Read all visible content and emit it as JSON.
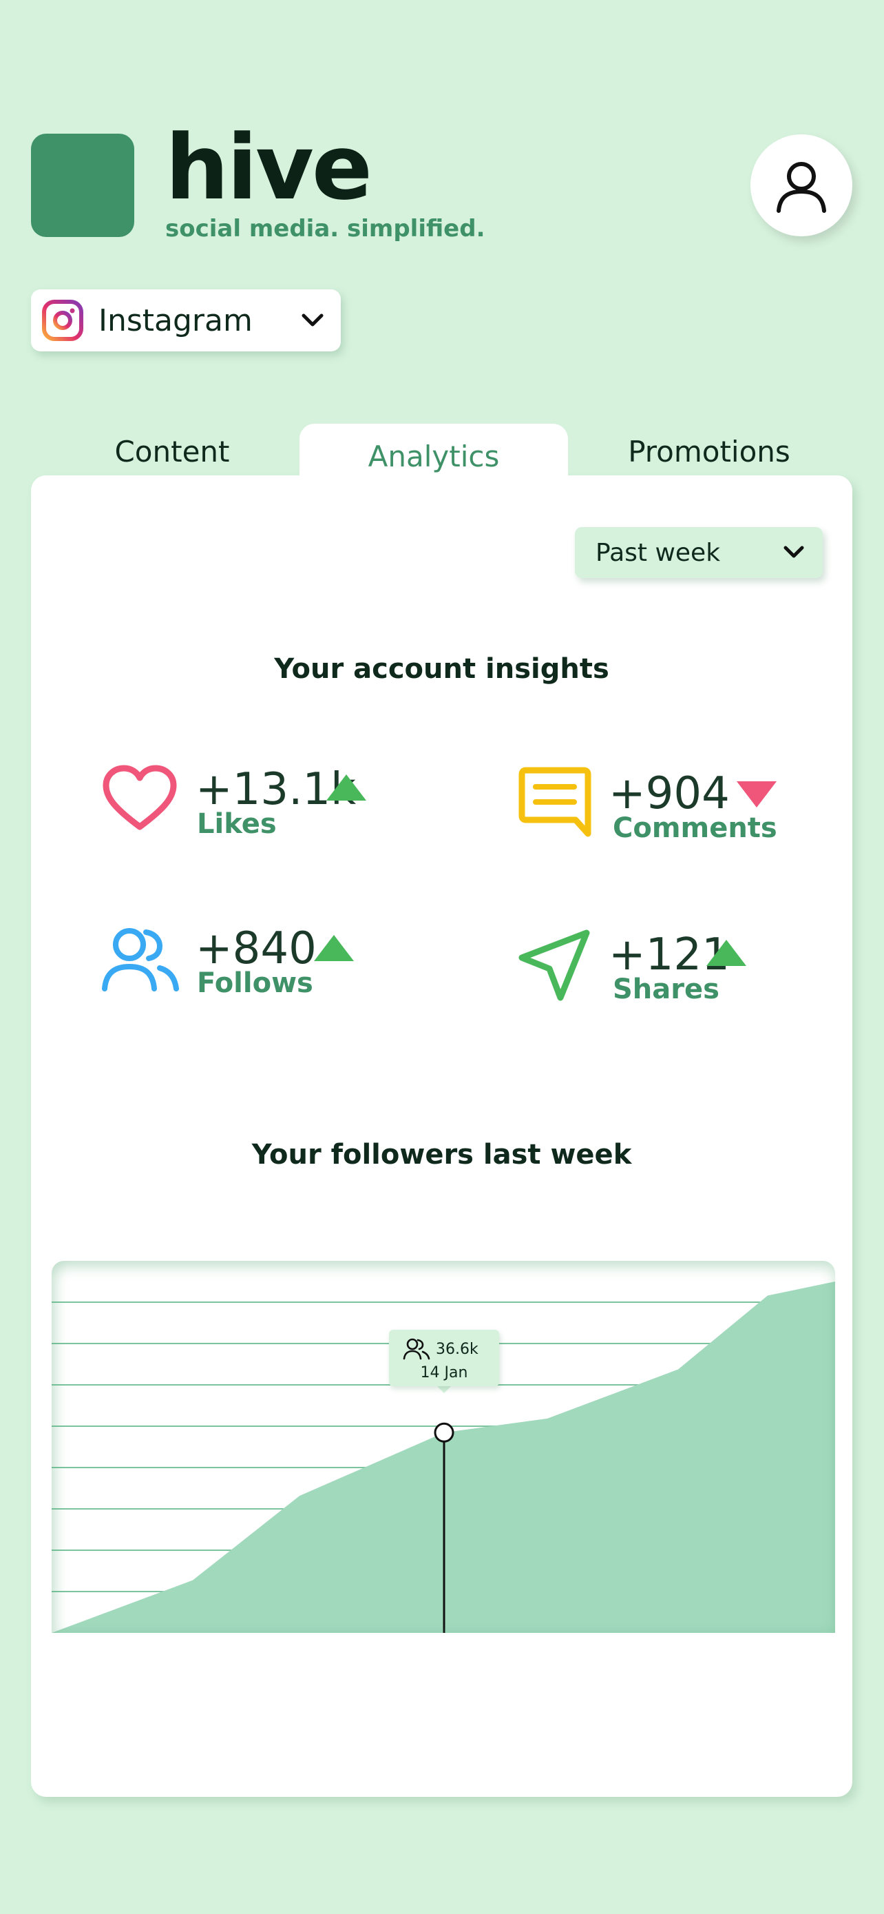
{
  "header": {
    "brand": "hive",
    "tagline": "social media. simplified."
  },
  "platform_select": {
    "label": "Instagram",
    "icon": "instagram-icon"
  },
  "tabs": [
    {
      "label": "Content",
      "active": false
    },
    {
      "label": "Analytics",
      "active": true
    },
    {
      "label": "Promotions",
      "active": false
    }
  ],
  "period_select": {
    "label": "Past week"
  },
  "insights": {
    "title": "Your account insights",
    "stats": [
      {
        "value": "+13.1k",
        "label": "Likes",
        "trend": "up",
        "icon": "heart-icon",
        "color": "#f0557a"
      },
      {
        "value": "+904",
        "label": "Comments",
        "trend": "down",
        "icon": "comment-icon",
        "color": "#f5c10e"
      },
      {
        "value": "+840",
        "label": "Follows",
        "trend": "up",
        "icon": "users-icon",
        "color": "#3aa9f4"
      },
      {
        "value": "+121",
        "label": "Shares",
        "trend": "up",
        "icon": "send-icon",
        "color": "#49b85a"
      }
    ]
  },
  "followers_chart": {
    "title": "Your followers last week",
    "tooltip": {
      "value": "36.6k",
      "date": "14 Jan"
    }
  },
  "colors": {
    "background": "#d6f2dd",
    "brand": "#3f9168",
    "trend_up": "#49b85a",
    "trend_down": "#f0557a",
    "chart_fill": "#a1d9bd"
  },
  "chart_data": {
    "type": "area",
    "title": "",
    "xlabel": "",
    "ylabel": "",
    "x": [
      0,
      1,
      2,
      3,
      4,
      5,
      6,
      7,
      8
    ],
    "series": [
      {
        "values": [
          0.0,
          0.15,
          0.39,
          0.57,
          0.61,
          0.75,
          0.96,
          1.0
        ]
      }
    ],
    "grid": true,
    "highlight": {
      "value": "36.6k",
      "date": "14 Jan"
    }
  }
}
